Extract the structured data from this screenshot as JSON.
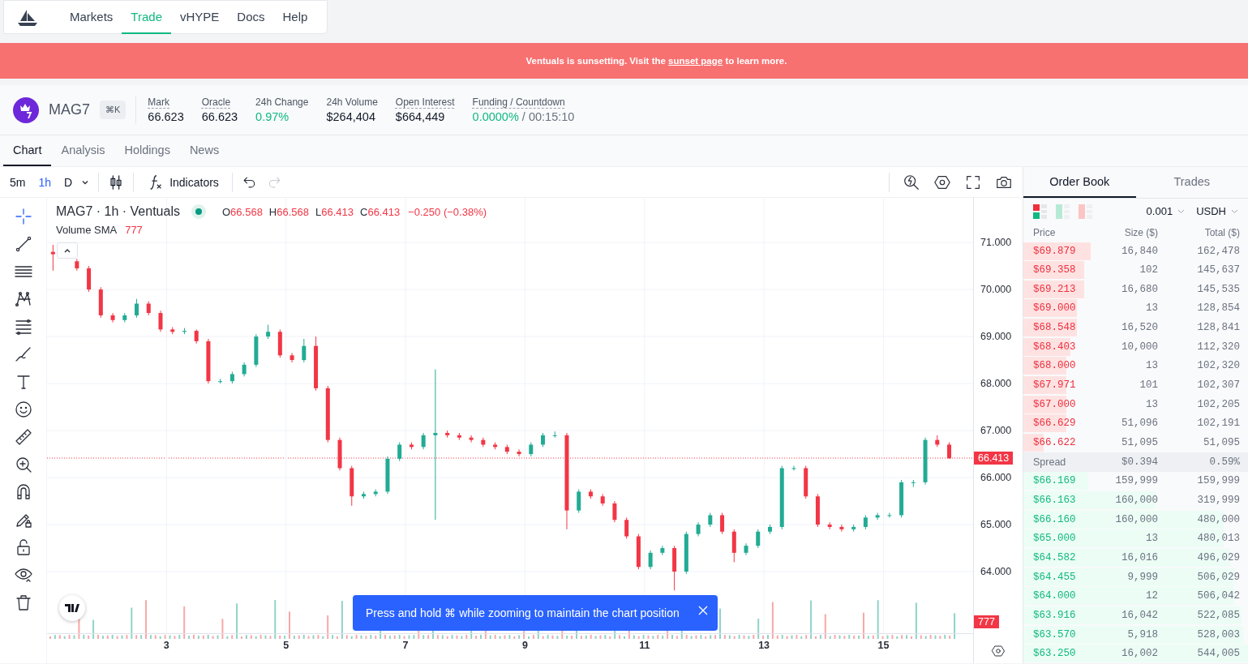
{
  "nav": {
    "items": [
      {
        "label": "Markets",
        "selected": false
      },
      {
        "label": "Trade",
        "selected": true
      },
      {
        "label": "vHYPE",
        "selected": false
      },
      {
        "label": "Docs",
        "selected": false
      },
      {
        "label": "Help",
        "selected": false
      }
    ]
  },
  "banner": {
    "text": "Ventuals is sunsetting. Visit the ",
    "link": "sunset page",
    "text_after": " to learn more."
  },
  "market": {
    "symbol": "MAG7",
    "shortcut": "⌘K",
    "stats": [
      {
        "label": "Mark",
        "underlined": true,
        "value": "66.623",
        "kind": "plain"
      },
      {
        "label": "Oracle",
        "underlined": true,
        "value": "66.623",
        "kind": "plain"
      },
      {
        "label": "24h Change",
        "underlined": false,
        "value": "0.97%",
        "kind": "positive"
      },
      {
        "label": "24h Volume",
        "underlined": false,
        "value": "$264,404",
        "kind": "plain"
      },
      {
        "label": "Open Interest",
        "underlined": true,
        "value": "$664,449",
        "kind": "plain"
      },
      {
        "label": "Funding / Countdown",
        "underlined": true,
        "value": "0.0000%",
        "kind": "positive",
        "suffix": " / 00:15:10"
      }
    ]
  },
  "tabs": [
    {
      "label": "Chart",
      "selected": true
    },
    {
      "label": "Analysis",
      "selected": false
    },
    {
      "label": "Holdings",
      "selected": false
    },
    {
      "label": "News",
      "selected": false
    }
  ],
  "chart_toolbar": {
    "intervals": [
      {
        "label": "5m",
        "selected": false
      },
      {
        "label": "1h",
        "selected": true
      },
      {
        "label": "D",
        "selected": false
      }
    ],
    "indicators": "Indicators",
    "redo_disabled": true
  },
  "tools": [
    {
      "kind": "crosshair",
      "selected": true
    },
    {
      "kind": "line",
      "selected": false
    },
    {
      "kind": "hlines",
      "selected": false
    },
    {
      "kind": "pattern",
      "selected": false
    },
    {
      "kind": "fib",
      "selected": false
    },
    {
      "kind": "brush",
      "selected": false
    },
    {
      "kind": "text",
      "selected": false
    },
    {
      "kind": "smiley",
      "selected": false
    },
    {
      "kind": "ruler",
      "selected": false
    },
    {
      "kind": "zoom",
      "selected": false
    },
    {
      "kind": "magnet",
      "selected": false
    },
    {
      "kind": "pencillock",
      "selected": false
    },
    {
      "kind": "lock",
      "selected": false
    },
    {
      "kind": "eye",
      "selected": false
    },
    {
      "kind": "trash",
      "selected": false
    }
  ],
  "chart": {
    "title": "MAG7 · 1h · Ventuals",
    "ohlc": [
      {
        "label": "O",
        "value": "66.568"
      },
      {
        "label": "H",
        "value": "66.568"
      },
      {
        "label": "L",
        "value": "66.413"
      },
      {
        "label": "C",
        "value": "66.413"
      }
    ],
    "change": "−0.250 (−0.38%)",
    "volume_label": "Volume SMA",
    "volume_value": "777",
    "last_price": "66.413",
    "volume_badge": "777",
    "toast": "Press and hold ⌘ while zooming to maintain the chart position",
    "chart_data": {
      "type": "candlestick",
      "xlim": [
        1,
        16.5
      ],
      "ylim": [
        62.69,
        71.95
      ],
      "grid": true,
      "yticks": [
        {
          "value": 71,
          "label": "71.000"
        },
        {
          "value": 70,
          "label": "70.000"
        },
        {
          "value": 69,
          "label": "69.000"
        },
        {
          "value": 68,
          "label": "68.000"
        },
        {
          "value": 67,
          "label": "67.000"
        },
        {
          "value": 66,
          "label": "66.000"
        },
        {
          "value": 65,
          "label": "65.000"
        },
        {
          "value": 64,
          "label": "64.000"
        }
      ],
      "xticks": [
        {
          "value": 3,
          "label": "3"
        },
        {
          "value": 5,
          "label": "5"
        },
        {
          "value": 7,
          "label": "7"
        },
        {
          "value": 9,
          "label": "9"
        },
        {
          "value": 11,
          "label": "11"
        },
        {
          "value": 13,
          "label": "13"
        },
        {
          "value": 15,
          "label": "15"
        }
      ],
      "x": [
        1.1,
        1.5,
        1.7,
        1.9,
        2.1,
        2.3,
        2.5,
        2.7,
        2.9,
        3.1,
        3.3,
        3.5,
        3.7,
        3.9,
        4.1,
        4.3,
        4.5,
        4.7,
        4.9,
        5.1,
        5.3,
        5.5,
        5.7,
        5.9,
        6.1,
        6.3,
        6.5,
        6.7,
        6.9,
        7.1,
        7.3,
        7.5,
        7.7,
        7.9,
        8.1,
        8.3,
        8.5,
        8.7,
        8.9,
        9.1,
        9.3,
        9.5,
        9.7,
        9.9,
        10.1,
        10.3,
        10.5,
        10.7,
        10.9,
        11.1,
        11.3,
        11.5,
        11.7,
        11.9,
        12.1,
        12.3,
        12.5,
        12.7,
        12.9,
        13.1,
        13.3,
        13.5,
        13.7,
        13.9,
        14.1,
        14.3,
        14.5,
        14.7,
        14.9,
        15.1,
        15.3,
        15.5,
        15.7,
        15.9,
        16.1
      ],
      "ohlc": [
        [
          70.8,
          70.95,
          70.4,
          70.75
        ],
        [
          70.6,
          70.65,
          70.4,
          70.45
        ],
        [
          70.45,
          70.5,
          69.95,
          70.0
        ],
        [
          70.0,
          70.05,
          69.4,
          69.45
        ],
        [
          69.45,
          69.5,
          69.3,
          69.35
        ],
        [
          69.35,
          69.5,
          69.3,
          69.45
        ],
        [
          69.45,
          69.8,
          69.4,
          69.7
        ],
        [
          69.7,
          69.75,
          69.45,
          69.5
        ],
        [
          69.5,
          69.55,
          69.1,
          69.15
        ],
        [
          69.15,
          69.2,
          69.05,
          69.1
        ],
        [
          69.1,
          69.18,
          69.05,
          69.12
        ],
        [
          69.12,
          69.15,
          68.85,
          68.9
        ],
        [
          68.9,
          68.95,
          68.0,
          68.05
        ],
        [
          68.05,
          68.1,
          68.0,
          68.05
        ],
        [
          68.05,
          68.25,
          68.0,
          68.2
        ],
        [
          68.2,
          68.45,
          68.15,
          68.4
        ],
        [
          68.4,
          69.05,
          68.35,
          69.0
        ],
        [
          69.0,
          69.25,
          68.95,
          69.1
        ],
        [
          69.1,
          69.15,
          68.55,
          68.6
        ],
        [
          68.6,
          68.65,
          68.45,
          68.5
        ],
        [
          68.5,
          68.95,
          68.45,
          68.8
        ],
        [
          68.8,
          69.0,
          67.85,
          67.9
        ],
        [
          67.9,
          67.95,
          66.75,
          66.8
        ],
        [
          66.8,
          66.85,
          66.15,
          66.2
        ],
        [
          66.2,
          66.25,
          65.4,
          65.6
        ],
        [
          65.6,
          65.7,
          65.55,
          65.65
        ],
        [
          65.65,
          65.75,
          65.6,
          65.7
        ],
        [
          65.7,
          66.45,
          65.65,
          66.4
        ],
        [
          66.4,
          66.75,
          66.35,
          66.7
        ],
        [
          66.7,
          66.75,
          66.6,
          66.65
        ],
        [
          66.65,
          66.95,
          66.6,
          66.9
        ],
        [
          66.9,
          68.3,
          65.1,
          66.95
        ],
        [
          66.95,
          67.0,
          66.85,
          66.9
        ],
        [
          66.9,
          66.95,
          66.8,
          66.85
        ],
        [
          66.85,
          66.9,
          66.75,
          66.8
        ],
        [
          66.8,
          66.85,
          66.65,
          66.7
        ],
        [
          66.7,
          66.75,
          66.6,
          66.65
        ],
        [
          66.65,
          66.7,
          66.5,
          66.55
        ],
        [
          66.55,
          66.6,
          66.45,
          66.5
        ],
        [
          66.5,
          66.75,
          66.45,
          66.7
        ],
        [
          66.7,
          66.95,
          66.65,
          66.9
        ],
        [
          66.9,
          66.98,
          66.85,
          66.9
        ],
        [
          66.9,
          66.95,
          64.9,
          65.3
        ],
        [
          65.3,
          65.75,
          65.25,
          65.7
        ],
        [
          65.7,
          65.75,
          65.55,
          65.6
        ],
        [
          65.6,
          65.65,
          65.4,
          65.45
        ],
        [
          65.45,
          65.5,
          65.05,
          65.1
        ],
        [
          65.1,
          65.15,
          64.7,
          64.75
        ],
        [
          64.75,
          64.8,
          64.05,
          64.1
        ],
        [
          64.1,
          64.45,
          64.05,
          64.4
        ],
        [
          64.4,
          64.55,
          64.35,
          64.5
        ],
        [
          64.5,
          64.55,
          63.6,
          64.0
        ],
        [
          64.0,
          64.85,
          63.95,
          64.8
        ],
        [
          64.8,
          65.05,
          64.75,
          65.0
        ],
        [
          65.0,
          65.25,
          64.95,
          65.2
        ],
        [
          65.2,
          65.25,
          64.8,
          64.85
        ],
        [
          64.85,
          64.9,
          64.2,
          64.4
        ],
        [
          64.4,
          64.6,
          64.35,
          64.55
        ],
        [
          64.55,
          64.9,
          64.5,
          64.85
        ],
        [
          64.85,
          65.0,
          64.8,
          64.95
        ],
        [
          64.95,
          66.25,
          64.9,
          66.2
        ],
        [
          66.2,
          66.25,
          66.15,
          66.2
        ],
        [
          66.2,
          66.25,
          65.55,
          65.6
        ],
        [
          65.6,
          65.65,
          64.95,
          65.0
        ],
        [
          65.0,
          65.05,
          64.9,
          64.95
        ],
        [
          64.95,
          65.0,
          64.85,
          64.9
        ],
        [
          64.9,
          65.0,
          64.85,
          64.95
        ],
        [
          64.95,
          65.2,
          64.9,
          65.15
        ],
        [
          65.15,
          65.25,
          65.1,
          65.2
        ],
        [
          65.2,
          65.25,
          65.15,
          65.2
        ],
        [
          65.2,
          65.95,
          65.15,
          65.9
        ],
        [
          65.9,
          65.95,
          65.8,
          65.9
        ],
        [
          65.9,
          66.85,
          65.85,
          66.8
        ],
        [
          66.8,
          66.9,
          66.65,
          66.7
        ],
        [
          66.7,
          66.75,
          66.4,
          66.41
        ]
      ]
    }
  },
  "order_book": {
    "tabs": [
      {
        "label": "Order Book",
        "selected": true
      },
      {
        "label": "Trades",
        "selected": false
      }
    ],
    "tick_size": "0.001",
    "currency": "USDH",
    "columns": [
      "Price",
      "Size ($)",
      "Total ($)"
    ],
    "asks": [
      {
        "price": "$69.879",
        "size": "16,840",
        "total": "162,478"
      },
      {
        "price": "$69.358",
        "size": "102",
        "total": "145,637"
      },
      {
        "price": "$69.213",
        "size": "16,680",
        "total": "145,535"
      },
      {
        "price": "$69.000",
        "size": "13",
        "total": "128,854"
      },
      {
        "price": "$68.548",
        "size": "16,520",
        "total": "128,841"
      },
      {
        "price": "$68.403",
        "size": "10,000",
        "total": "112,320"
      },
      {
        "price": "$68.000",
        "size": "13",
        "total": "102,320"
      },
      {
        "price": "$67.971",
        "size": "101",
        "total": "102,307"
      },
      {
        "price": "$67.000",
        "size": "13",
        "total": "102,205"
      },
      {
        "price": "$66.629",
        "size": "51,096",
        "total": "102,191"
      },
      {
        "price": "$66.622",
        "size": "51,095",
        "total": "51,095"
      }
    ],
    "spread": {
      "label": "Spread",
      "value": "$0.394",
      "percent": "0.59%"
    },
    "bids": [
      {
        "price": "$66.169",
        "size": "159,999",
        "total": "159,999"
      },
      {
        "price": "$66.163",
        "size": "160,000",
        "total": "319,999"
      },
      {
        "price": "$66.160",
        "size": "160,000",
        "total": "480,000"
      },
      {
        "price": "$65.000",
        "size": "13",
        "total": "480,013"
      },
      {
        "price": "$64.582",
        "size": "16,016",
        "total": "496,029"
      },
      {
        "price": "$64.455",
        "size": "9,999",
        "total": "506,029"
      },
      {
        "price": "$64.000",
        "size": "12",
        "total": "506,042"
      },
      {
        "price": "$63.916",
        "size": "16,042",
        "total": "522,085"
      },
      {
        "price": "$63.570",
        "size": "5,918",
        "total": "528,003"
      },
      {
        "price": "$63.250",
        "size": "16,002",
        "total": "544,005"
      }
    ]
  }
}
